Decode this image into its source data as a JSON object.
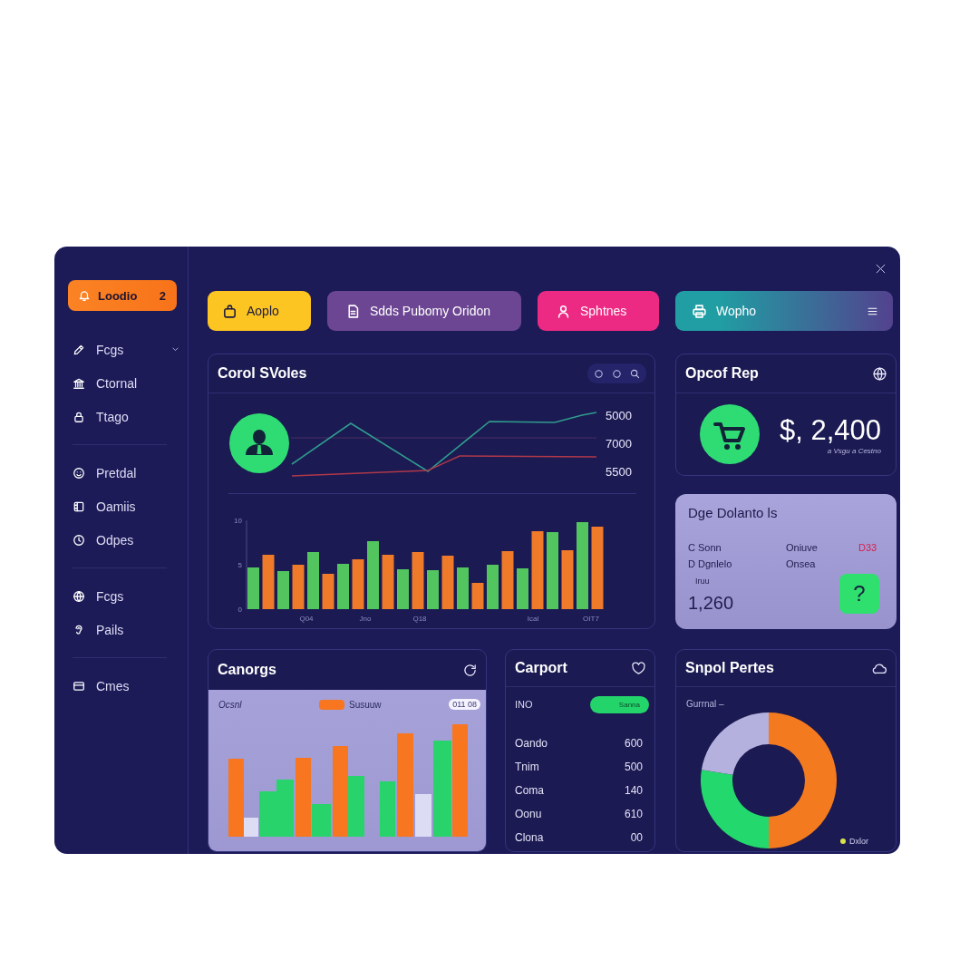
{
  "sidebar": {
    "main_button": {
      "label": "Loodio",
      "badge": "2"
    },
    "sections": [
      {
        "items": [
          {
            "label": "Fcgs",
            "kind": "dropdown"
          },
          {
            "label": "Ctornal",
            "kind": "link"
          },
          {
            "label": "Ttago",
            "kind": "link"
          }
        ]
      },
      {
        "items": [
          {
            "label": "Pretdal",
            "kind": "link"
          },
          {
            "label": "Oamiis",
            "kind": "link"
          },
          {
            "label": "Odpes",
            "kind": "link"
          }
        ]
      },
      {
        "items": [
          {
            "label": "Fcgs",
            "kind": "link"
          },
          {
            "label": "Pails",
            "kind": "link"
          }
        ]
      },
      {
        "items": [
          {
            "label": "Cmes",
            "kind": "link"
          }
        ]
      }
    ]
  },
  "actions": [
    {
      "label": "Aoplo",
      "color": "#fcc521",
      "kind": "plain"
    },
    {
      "label": "Sdds Pubomy Oridon",
      "color": "#6c4692",
      "kind": "plain"
    },
    {
      "label": "Sphtnes",
      "color": "#ec2a83",
      "kind": "plain"
    },
    {
      "label": "Wopho",
      "color": "#209ea3",
      "kind": "menu"
    }
  ],
  "sales": {
    "title": "Corol SVoles",
    "line_labels": [
      "5000",
      "7000",
      "5500"
    ],
    "y_labels": [
      "10",
      "5",
      "0"
    ],
    "x_labels": [
      "Q04",
      "Jno",
      "Q18",
      "Ical",
      "OIT7"
    ]
  },
  "report": {
    "title": "Opcof Rep",
    "amount": "$, 2,400",
    "caption": "a Vsgu a Cestno"
  },
  "balance": {
    "title": "Dge Dolanto ls",
    "rows": [
      {
        "label": "C Sonn",
        "value": "Oniuve",
        "flag": "D33"
      },
      {
        "label": "D Dgnlelo",
        "value": "Onsea"
      }
    ],
    "note": "Iruu",
    "total": "1,260",
    "help": "?"
  },
  "changes": {
    "title": "Canorgs",
    "legend_title": "Ocsnl",
    "series_label": "Susuuw",
    "period": "011 08"
  },
  "carport": {
    "title": "Carport",
    "status": {
      "label": "INO",
      "badge": "Sanna"
    },
    "rows": [
      {
        "label": "Oando",
        "value": "600"
      },
      {
        "label": "Tnim",
        "value": "500"
      },
      {
        "label": "Coma",
        "value": "140"
      },
      {
        "label": "Oonu",
        "value": "610"
      },
      {
        "label": "Clona",
        "value": "00"
      }
    ]
  },
  "shares": {
    "title": "Snpol Pertes",
    "subtitle": "Gurrnal –",
    "legend": "Dxlor"
  }
}
